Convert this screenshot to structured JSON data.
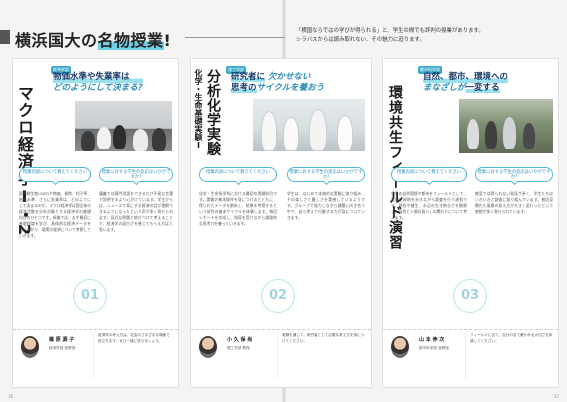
{
  "header": {
    "title_plain": "横浜国大の",
    "title_highlight": "名物授業",
    "title_mark": "!",
    "note_line1": "「横国ならではの学びが得られる」と、学生の間でも評判の授業があります。",
    "note_line2": "シラバスからは読み取れない、その魅力に迫ります。"
  },
  "columns": [
    {
      "badge": "経済学部",
      "title": "マクロ経済学Ⅰ・2",
      "topic_line1": "物価水準や失業率は",
      "topic_line2": "どのようにして決まる?",
      "bubble_left": "授業内容について教えてください",
      "bubble_right": "授業に対する学生の反応はいかがですか?",
      "stamp": "01",
      "prof_name": "篠 原 源 子",
      "prof_role": "経済学部 准教授",
      "body_left": "国内総生産(GDP)や物価、貨幣、利子率、物価水準、さらに失業率は、どのようにして決まるのか。マクロ経済学は国全体の経済活動を分析対象とする経済学の基礎科目のひとつです。授業では、まず最初に基礎理論を学び、具体的な経済データを用いながら、現実の経済について考察していきます。",
      "body_right": "講義では専門用語をできるだけ平易な言葉で説明するよう心がけています。学生からは、ニュースで耳にする経済の話が理解できるようになったという声が多く寄せられます。身近な問題と結びつけて考えることで、経済学の面白さを感じてもらえればと思います。",
      "prof_msg": "経済学の考え方は、社会のさまざまな場面で役立ちます。ぜひ一緒に学びましょう。"
    },
    {
      "badge": "理工学部",
      "title": "化学・生命基礎実験Ⅰ",
      "title_main": "分析化学実験",
      "topic_line1": "研究者に",
      "topic_line1b": "欠かせない",
      "topic_line2": "思考の",
      "topic_line2b": "サイクルを養おう",
      "bubble_left": "授業内容について教えてください",
      "bubble_right": "授業に対する学生の反応はいかがですか?",
      "stamp": "02",
      "prof_name": "小 久 保 尚",
      "prof_role": "理工学部 教授",
      "body_left": "化学・生命系学科における最初の実験科目です。実験の基本操作を身につけるとともに、得られたデータを解析し、結果を考察するという研究の基本サイクルを体験します。毎回レポートを作成し、指導を受けながら論理的な思考力を養っていきます。",
      "body_right": "学生は、はじめて本格的な実験に取り組み、その楽しさと難しさを実感しているようです。グループで協力しながら課題に向き合う中で、自ら考えて行動する力が身についていきます。",
      "prof_msg": "実験を通して、研究者として必要な考え方を身につけてください。"
    },
    {
      "badge": "都市科学部",
      "title": "環境共生フィールド演習",
      "topic_line1": "自然、都市、環境への",
      "topic_line2": "まなざしが",
      "topic_line2b": "一変する",
      "bubble_left": "授業内容について教えてください",
      "bubble_right": "授業に対する学生の反応はいかがですか?",
      "stamp": "03",
      "prof_name": "山 本 伸 次",
      "prof_role": "都市科学部 准教授",
      "body_left": "学外の自然環境や都市をフィールドとして、実際に現地を歩きながら調査を行う演習です。地形や植生、水辺の生き物などを観察し、自然と人間の暮らしの関わりについて考えます。",
      "body_right": "教室では得られない発見が多く、学生たちはいきいきと調査に取り組んでいます。普段見慣れた風景の見え方が大きく変わったという感想が多く寄せられています。",
      "prof_msg": "フィールドに出て、自分の目で確かめる大切さを体感してください。"
    }
  ],
  "folio": {
    "left": "16",
    "right": "17"
  }
}
